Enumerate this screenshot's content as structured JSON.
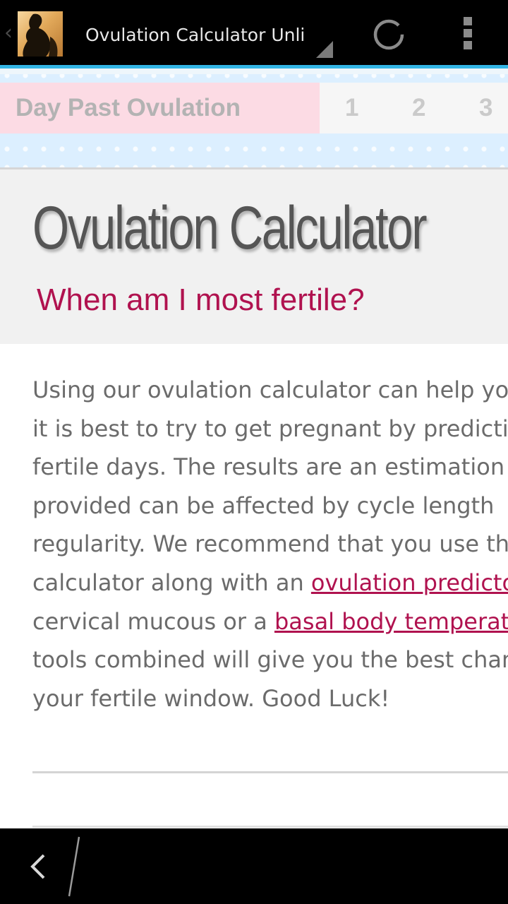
{
  "action_bar": {
    "title": "Ovulation Calculator Unlimited",
    "icons": [
      "up-caret-icon",
      "app-icon",
      "spinner-dropdown-icon",
      "refresh-icon",
      "overflow-menu-icon"
    ]
  },
  "banner": {
    "label": "Day Past Ovulation",
    "days": [
      "1",
      "2",
      "3"
    ]
  },
  "hero": {
    "title": "Ovulation Calculator",
    "subtitle": "When am I most fertile?"
  },
  "body": {
    "lines": [
      "Using our ovulation calculator can help you",
      "it is best to try to get pregnant by predicting",
      "fertile days. The results are an estimation",
      "provided can be affected by cycle length",
      "regularity. We recommend that you use this"
    ],
    "line6_prefix": "calculator along with an ",
    "link1": "ovulation predictor",
    "line7_prefix": "cervical mucous or a ",
    "link2": "basal body temperature",
    "line8": "tools combined will give you the best chance",
    "line9": "your fertile window. Good Luck!"
  },
  "colors": {
    "accent": "#b0124f",
    "holo_blue": "#33b5e5",
    "banner_pink": "#fcdbe4",
    "banner_blue": "#dcefff"
  },
  "nav_bar": {
    "icons": [
      "back-icon"
    ]
  }
}
